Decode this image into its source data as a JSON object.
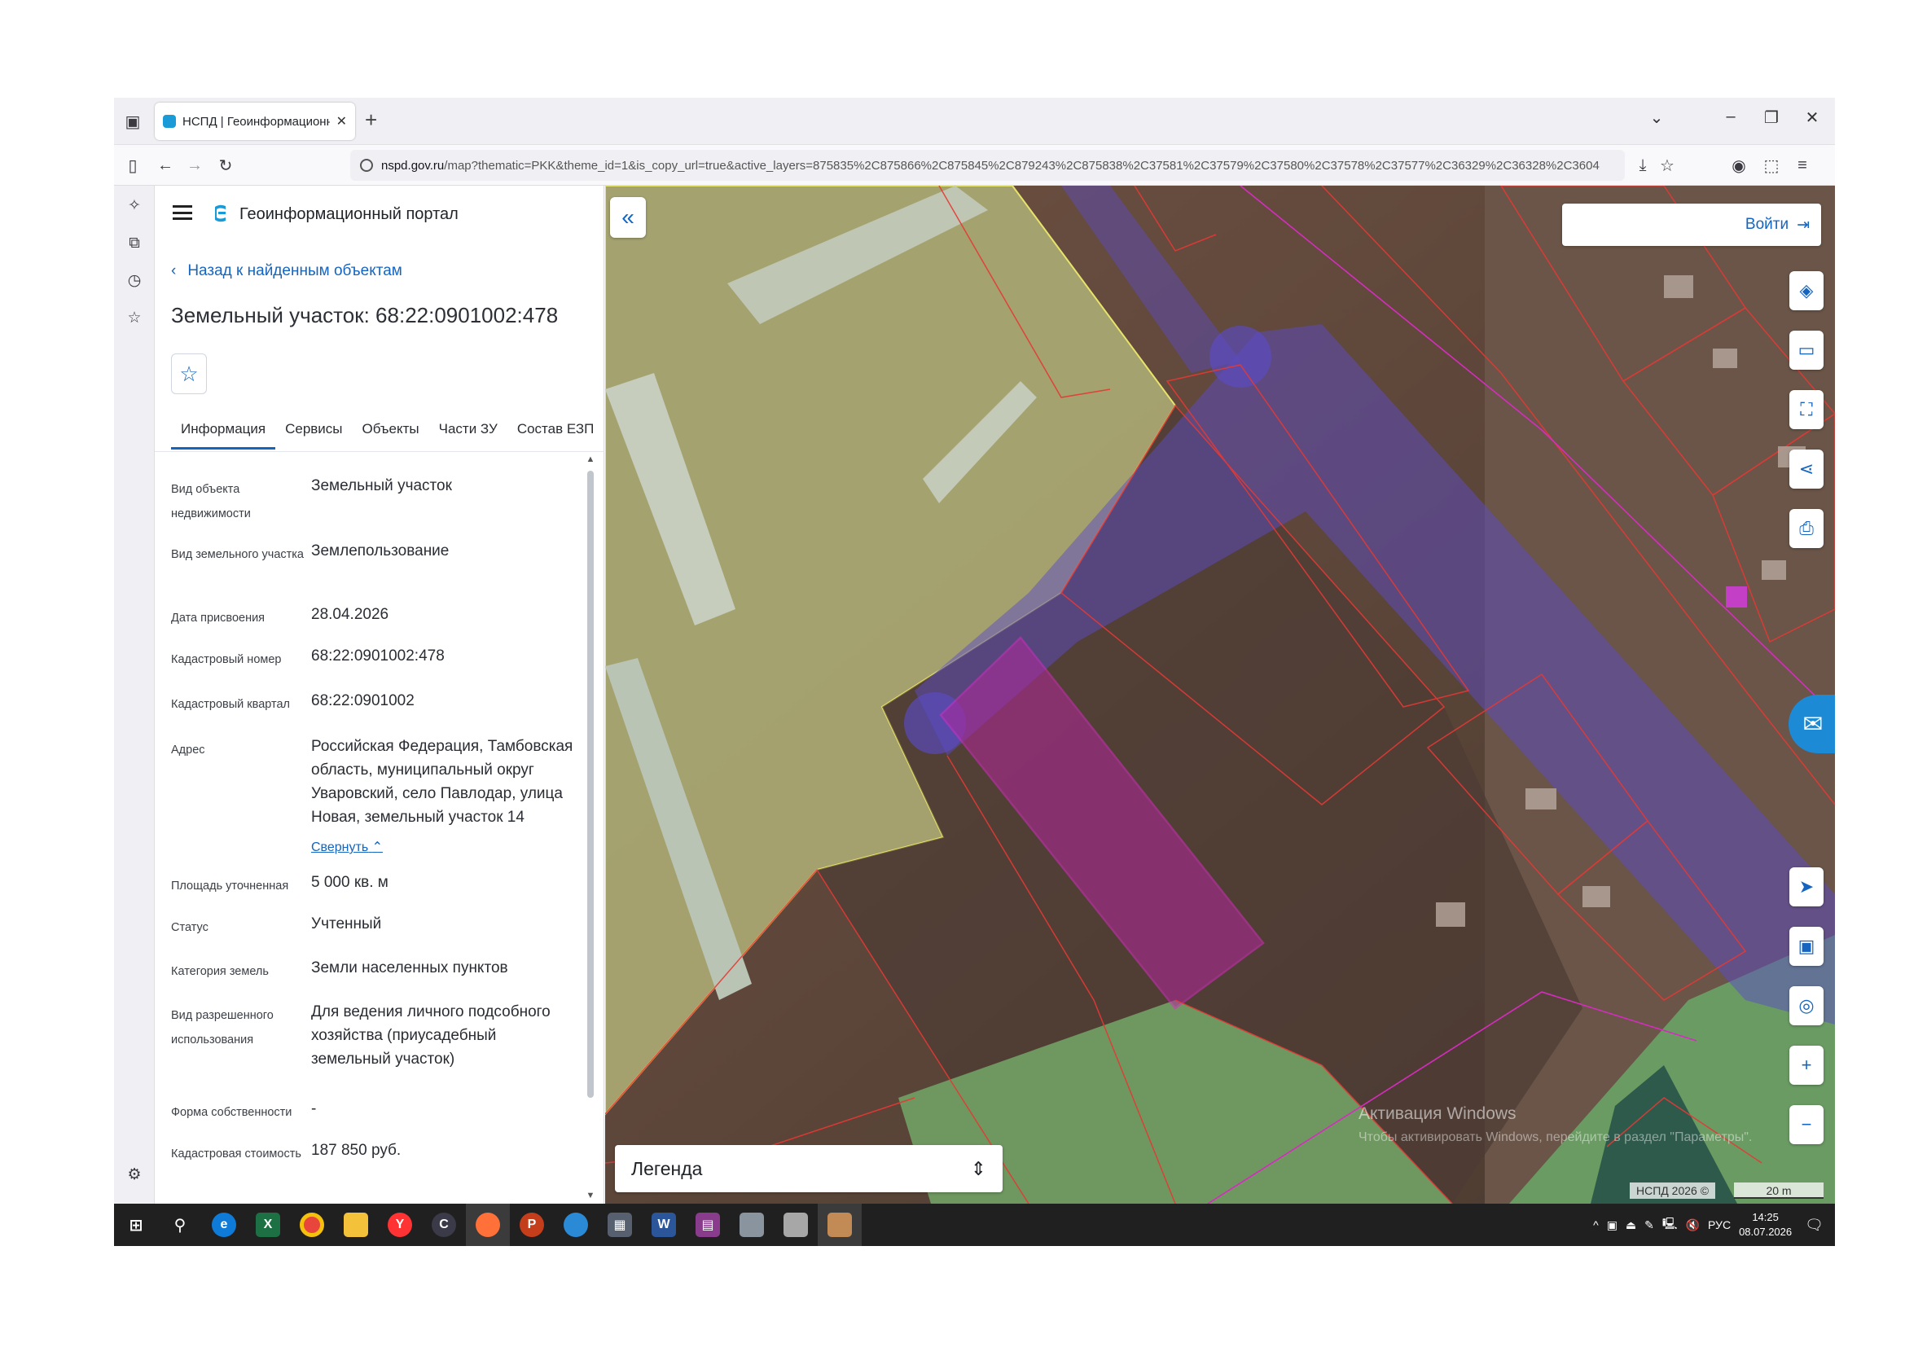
{
  "browser": {
    "tab_title": "НСПД | Геоинформационный",
    "url_host": "nspd.gov.ru",
    "url_path": "/map?thematic=PKK&theme_id=1&is_copy_url=true&active_layers=875835%2C875866%2C875845%2C879243%2C875838%2C37581%2C37579%2C37580%2C37578%2C37577%2C36329%2C36328%2C3604"
  },
  "portal": {
    "name": "Геоинформационный портал",
    "back_label": "Назад к найденным объектам",
    "object_title": "Земельный участок: 68:22:0901002:478"
  },
  "tabs": [
    "Информация",
    "Сервисы",
    "Объекты",
    "Части ЗУ",
    "Состав ЕЗП"
  ],
  "attributes": [
    {
      "label": "Вид объекта недвижимости",
      "value": "Земельный участок"
    },
    {
      "label": "Вид земельного участка",
      "value": "Землепользование"
    },
    {
      "label": "Дата присвоения",
      "value": "28.04.2026"
    },
    {
      "label": "Кадастровый номер",
      "value": "68:22:0901002:478"
    },
    {
      "label": "Кадастровый квартал",
      "value": "68:22:0901002"
    },
    {
      "label": "Адрес",
      "value": "Российская Федерация, Тамбовская область, муниципальный округ Уваровский, село Павлодар, улица Новая, земельный участок 14"
    },
    {
      "label": "Площадь уточненная",
      "value": "5 000 кв. м"
    },
    {
      "label": "Статус",
      "value": "Учтенный"
    },
    {
      "label": "Категория земель",
      "value": "Земли населенных пунктов"
    },
    {
      "label": "Вид разрешенного использования",
      "value": "Для ведения личного подсобного хозяйства (приусадебный земельный участок)"
    },
    {
      "label": "Форма собственности",
      "value": "-"
    },
    {
      "label": "Кадастровая стоимость",
      "value": "187 850 руб."
    }
  ],
  "collapse_label": "Свернуть",
  "map": {
    "login_label": "Войти",
    "legend_label": "Легенда",
    "watermark_title": "Активация Windows",
    "watermark_text": "Чтобы активировать Windows, перейдите в раздел \"Параметры\".",
    "copyright": "НСПД 2026 ©",
    "scale": "20 m"
  },
  "taskbar": {
    "lang": "РУС",
    "time": "14:25",
    "date": "08.07.2026"
  },
  "colors": {
    "accent": "#1565c0",
    "selected_parcel": "#b3279b",
    "zone_overlay": "#5b4bc4",
    "parcel_outline": "#e53935"
  }
}
